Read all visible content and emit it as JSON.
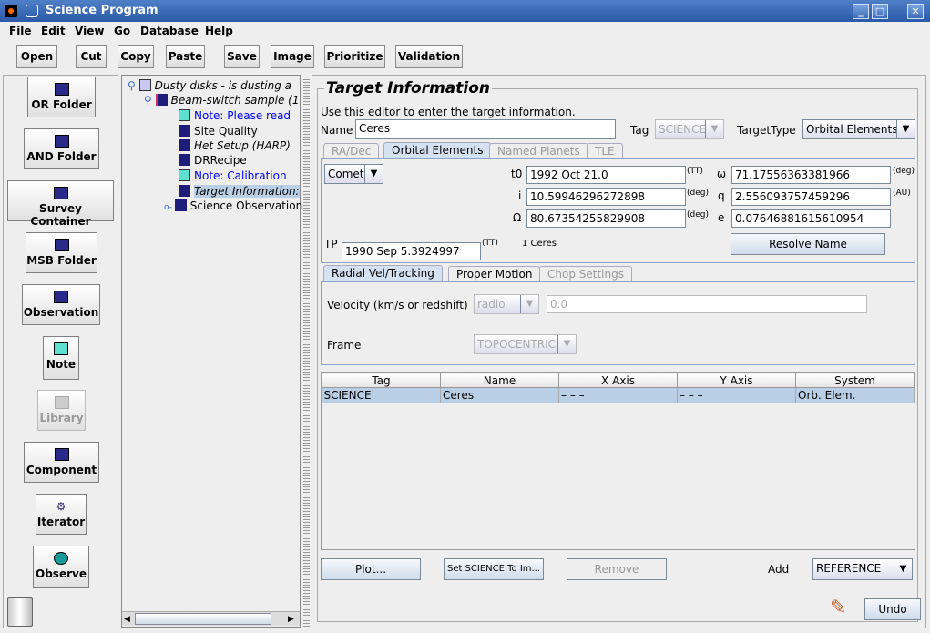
{
  "window": {
    "title": "Science Program"
  },
  "menu": [
    "File",
    "Edit",
    "View",
    "Go",
    "Database",
    "Help"
  ],
  "toolbar": [
    "Open",
    "Cut",
    "Copy",
    "Paste",
    "Save",
    "Image",
    "Prioritize",
    "Validation"
  ],
  "palette": [
    {
      "label": "OR Folder"
    },
    {
      "label": "AND Folder"
    },
    {
      "label": "Survey Container"
    },
    {
      "label": "MSB Folder"
    },
    {
      "label": "Observation"
    },
    {
      "label": "Note"
    },
    {
      "label": "Library",
      "disabled": true
    },
    {
      "label": "Component"
    },
    {
      "label": "Iterator"
    },
    {
      "label": "Observe"
    }
  ],
  "tree": [
    "Dusty disks - is dusting a",
    "Beam-switch sample (1",
    "Note: Please read",
    "Site Quality",
    "Het Setup (HARP)",
    "DRRecipe",
    "Note: Calibration",
    "Target Information:",
    "Science Observation"
  ],
  "target": {
    "title": "Target Information",
    "instructions": "Use this editor to enter the target information.",
    "name_label": "Name",
    "name_value": "Ceres",
    "tag_label": "Tag",
    "tag_value": "SCIENCE",
    "type_label": "TargetType",
    "type_value": "Orbital Elements",
    "tabs": [
      "RA/Dec",
      "Orbital Elements",
      "Named Planets",
      "TLE"
    ],
    "orbit_type": "Comet",
    "t0_label": "t0",
    "t0": "1992 Oct 21.0",
    "t0_unit": "(TT)",
    "i_label": "i",
    "i": "10.59946296272898",
    "i_unit": "(deg)",
    "Omega_label": "Ω",
    "Omega": "80.67354255829908",
    "Omega_unit": "(deg)",
    "omega_label": "ω",
    "omega": "71.17556363381966",
    "omega_unit": "(deg)",
    "q_label": "q",
    "q": "2.556093757459296",
    "q_unit": "(AU)",
    "e_label": "e",
    "e": "0.07646881615610954",
    "tp_label": "TP",
    "tp": "1990 Sep 5.3924997",
    "tp_unit": "(TT)",
    "object_name": "1 Ceres",
    "resolve": "Resolve Name",
    "tabs2": [
      "Radial Vel/Tracking",
      "Proper Motion",
      "Chop Settings"
    ],
    "velocity_label": "Velocity (km/s or redshift)",
    "velocity_type": "radio",
    "velocity_value": "0.0",
    "frame_label": "Frame",
    "frame_value": "TOPOCENTRIC",
    "table": {
      "headers": [
        "Tag",
        "Name",
        "X Axis",
        "Y Axis",
        "System"
      ],
      "rows": [
        [
          "SCIENCE",
          "Ceres",
          "– – –",
          "– – –",
          "Orb. Elem."
        ]
      ]
    },
    "plot": "Plot...",
    "set_science": "Set SCIENCE To Im...",
    "remove": "Remove",
    "add_label": "Add",
    "add_value": "REFERENCE"
  },
  "undo": "Undo"
}
